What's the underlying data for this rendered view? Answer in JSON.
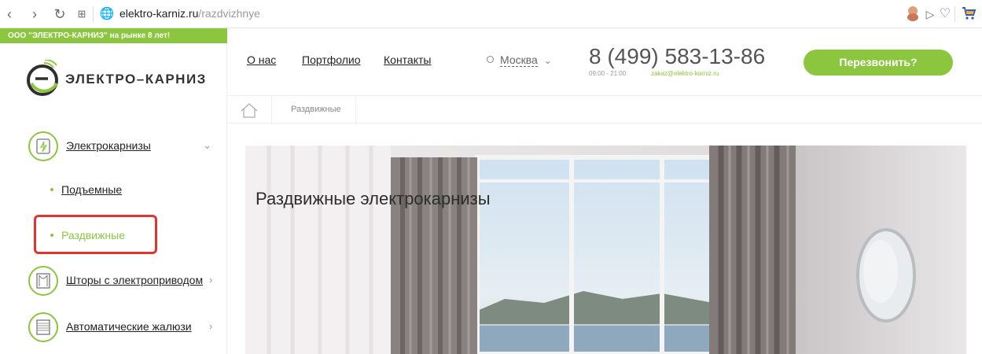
{
  "browser": {
    "url_host": "elektro-karniz.ru",
    "url_path": "/razdvizhnye"
  },
  "promo_text": "ООО \"ЭЛЕКТРО-КАРНИЗ\" на рынке 8 лет!",
  "logo_text": "ЭЛЕКТРО–КАРНИЗ",
  "sidebar": {
    "categories": [
      {
        "label": "Электрокарнизы",
        "icon": "curtain-rod-icon",
        "expanded": true
      },
      {
        "label": "Шторы с электроприводом",
        "icon": "curtains-icon"
      },
      {
        "label": "Автоматические жалюзи",
        "icon": "blinds-icon"
      }
    ],
    "subitems": [
      {
        "label": "Подъемные"
      },
      {
        "label": "Раздвижные",
        "active": true
      }
    ]
  },
  "header": {
    "nav": [
      "О нас",
      "Портфолио",
      "Контакты"
    ],
    "city": "Москва",
    "phone": "8 (499) 583-13-86",
    "hours": "09:00 - 21:00",
    "email": "zakaz@elektro-karniz.ru",
    "callback_label": "Перезвонить?"
  },
  "breadcrumb": {
    "current": "Раздвижные"
  },
  "hero": {
    "title": "Раздвижные электрокарнизы"
  },
  "colors": {
    "accent": "#8cc63f",
    "highlight": "#e0342e"
  }
}
